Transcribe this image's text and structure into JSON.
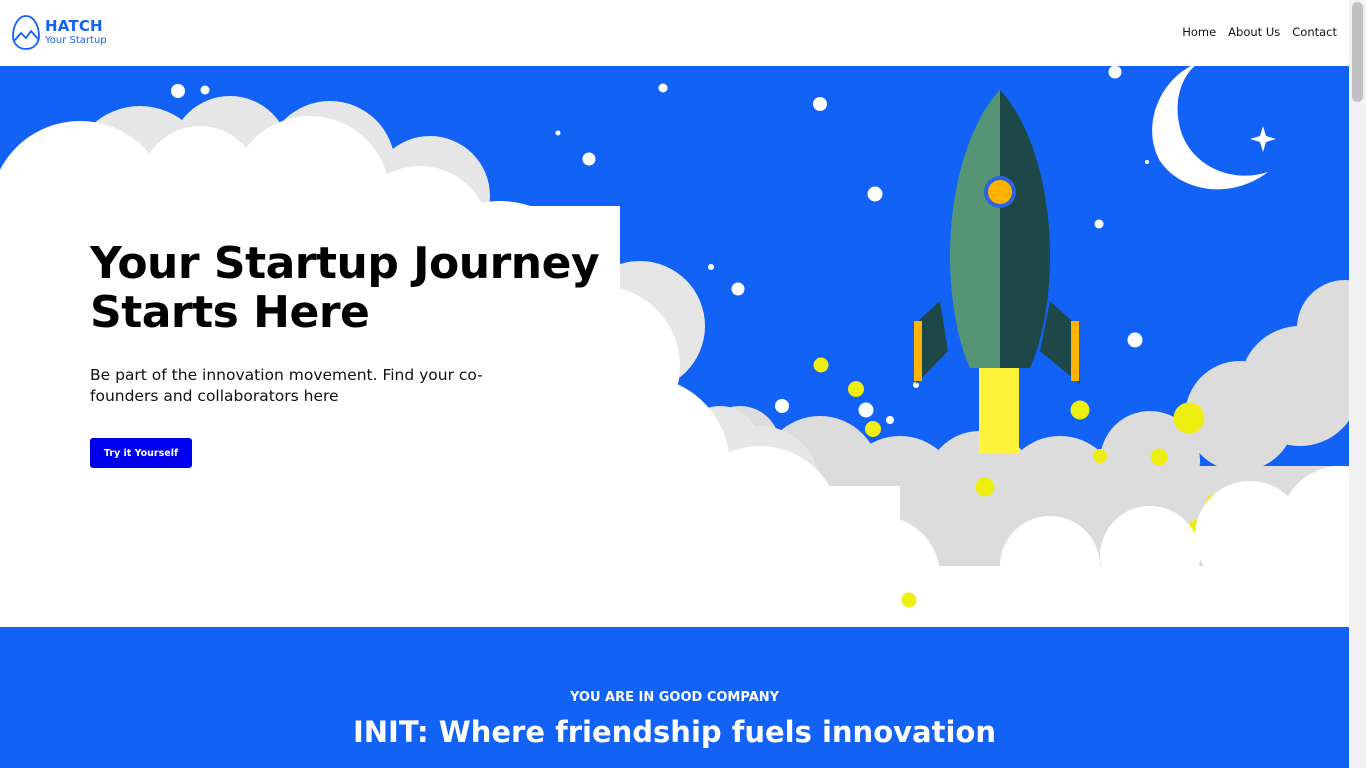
{
  "brand": {
    "title": "HATCH",
    "subtitle": "Your Startup",
    "color": "#1262F6"
  },
  "nav": {
    "items": [
      {
        "label": "Home"
      },
      {
        "label": "About Us"
      },
      {
        "label": "Contact"
      }
    ]
  },
  "hero": {
    "title": "Your Startup Journey Starts Here",
    "subtitle": "Be part of the innovation movement. Find your co-founders and collaborators here",
    "cta_label": "Try it Yourself",
    "background": "#1262F6",
    "cta_color": "#0000EE"
  },
  "company": {
    "kicker": "YOU ARE IN GOOD COMPANY",
    "title": "INIT: Where friendship fuels innovation"
  },
  "icons": {
    "logo": "egg-mountain-icon",
    "illustration": "rocket-launch-illustration"
  }
}
